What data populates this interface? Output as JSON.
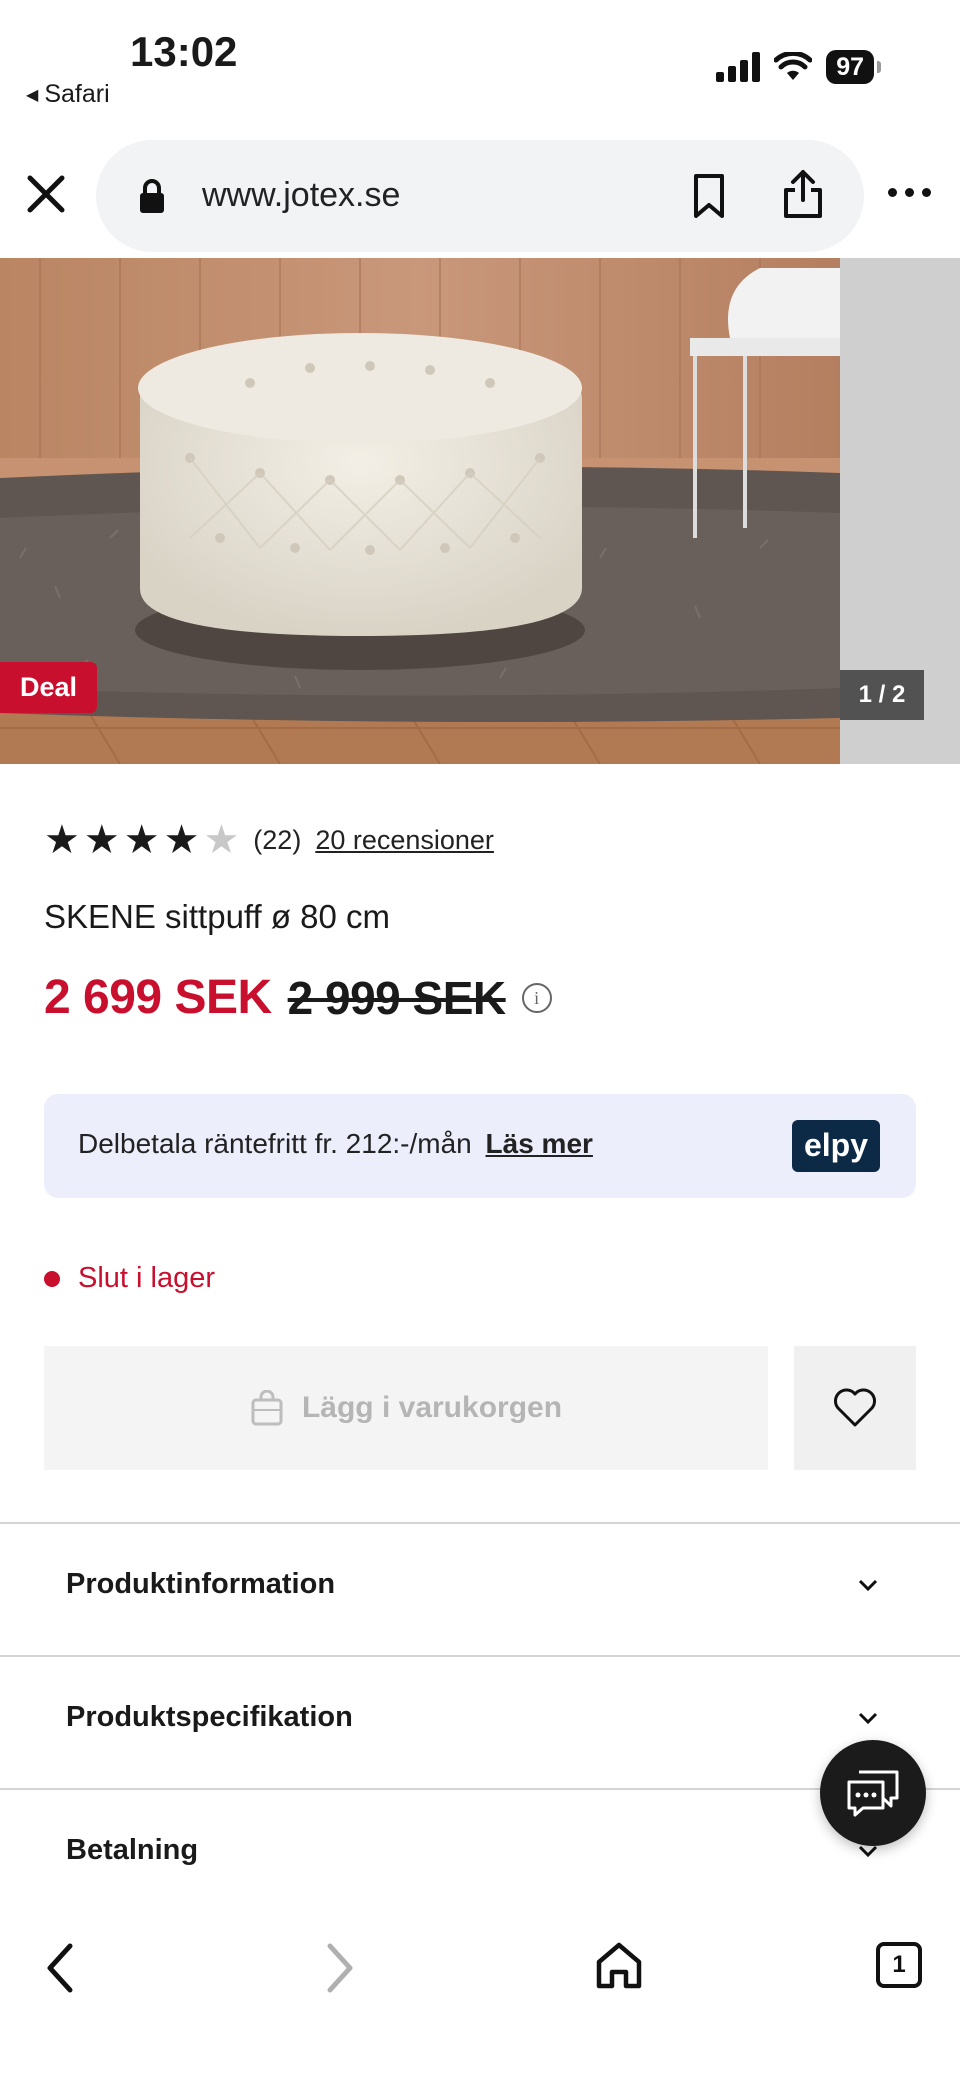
{
  "status_bar": {
    "time": "13:02",
    "back_app": "Safari",
    "battery": "97"
  },
  "browser": {
    "url": "www.jotex.se"
  },
  "gallery": {
    "badge": "Deal",
    "counter": "1 / 2"
  },
  "product": {
    "rating": 4,
    "rating_max": 5,
    "rating_count": "(22)",
    "reviews_link": "20 recensioner",
    "title": "SKENE sittpuff ø 80 cm",
    "price_now": "2 699 SEK",
    "price_old": "2 999 SEK",
    "info_icon": "i"
  },
  "elpy": {
    "text": "Delbetala räntefritt fr. 212:-/mån",
    "link": "Läs mer",
    "logo": "elpy"
  },
  "stock": {
    "label": "Slut i lager"
  },
  "actions": {
    "cart_label": "Lägg i varukorgen"
  },
  "accordion": [
    {
      "label": "Produktinformation"
    },
    {
      "label": "Produktspecifikation"
    },
    {
      "label": "Betalning"
    }
  ],
  "toolbar": {
    "tabs_count": "1"
  },
  "colors": {
    "accent_red": "#c8102e",
    "elpy_bg": "#eceefc",
    "elpy_logo": "#0c2a45"
  }
}
